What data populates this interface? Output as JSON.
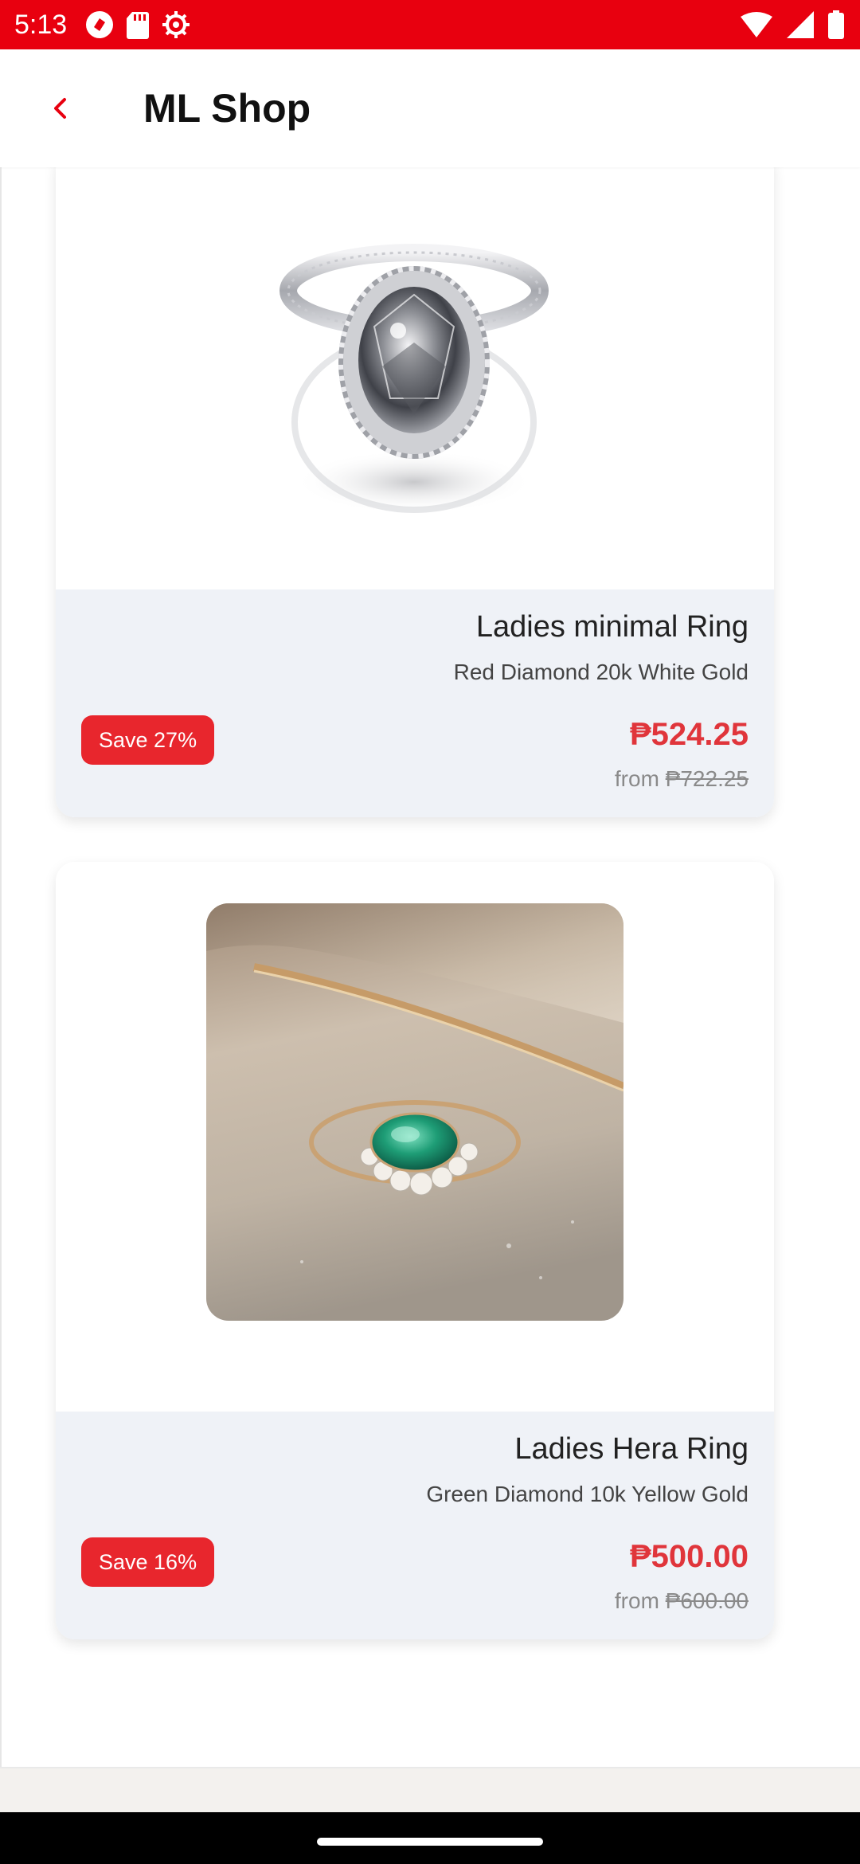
{
  "status_bar": {
    "time": "5:13",
    "icons": [
      "app-notification-icon",
      "sd-card-icon",
      "settings-icon",
      "wifi-icon",
      "signal-icon",
      "battery-icon"
    ]
  },
  "app_bar": {
    "title": "ML Shop",
    "back_icon": "chevron-left-icon",
    "accent_color": "#e8000f"
  },
  "products": [
    {
      "name": "Ladies minimal Ring",
      "variant": "Red Diamond 20k White Gold",
      "badge": "Save 27%",
      "price": "₱524.25",
      "from_label": "from",
      "original_price": "₱722.25",
      "image": "silver-oval-diamond-halo-ring"
    },
    {
      "name": "Ladies Hera Ring",
      "variant": "Green Diamond 10k Yellow Gold",
      "badge": "Save 16%",
      "price": "₱500.00",
      "from_label": "from",
      "original_price": "₱600.00",
      "image": "gold-ring-green-stone-photo"
    }
  ],
  "colors": {
    "price": "#e0353b",
    "badge": "#e8262d",
    "info_background": "#eff2f7"
  }
}
